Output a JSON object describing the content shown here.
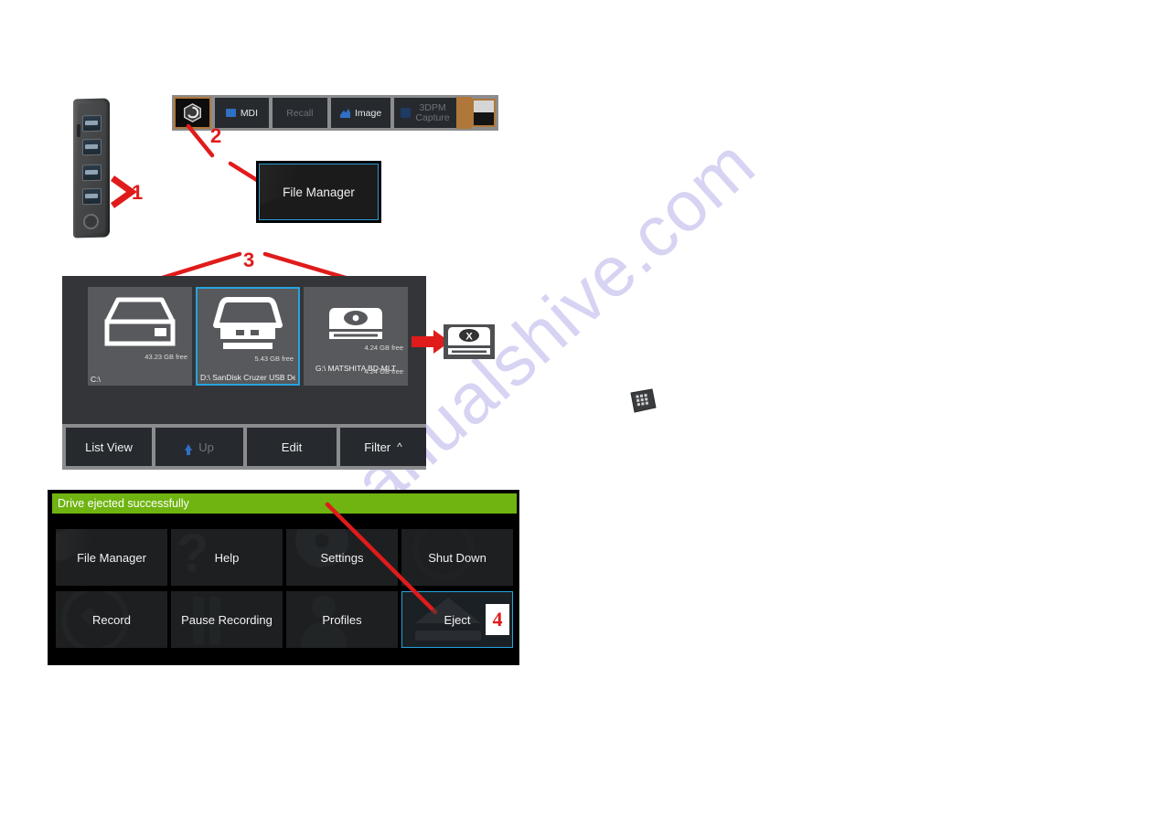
{
  "watermark": {
    "text": "manualshive.com"
  },
  "callouts": [
    {
      "id": "1",
      "label": "1"
    },
    {
      "id": "2",
      "label": "2"
    },
    {
      "id": "3",
      "label": "3"
    },
    {
      "id": "4",
      "label": "4"
    }
  ],
  "device_panel": {
    "name": "controller-side-ports",
    "usb_port_count": 4
  },
  "toolbar": {
    "logo_icon": "siemens-hmi-logo-icon",
    "buttons": [
      {
        "label": "MDI",
        "icon": "mdi-icon",
        "state": "enabled"
      },
      {
        "label": "Recall",
        "icon": "",
        "state": "disabled"
      },
      {
        "label": "Image",
        "icon": "image-icon",
        "state": "enabled"
      },
      {
        "label": "3DPM\nCapture",
        "label_line1": "3DPM",
        "label_line2": "Capture",
        "icon": "3dpm-icon",
        "state": "disabled"
      }
    ],
    "right_tile_icon": "screen-toggle-icon"
  },
  "file_manager_tile": {
    "label": "File Manager",
    "selected": true,
    "accent": "#2e9bd6"
  },
  "drives_panel": {
    "drives": [
      {
        "icon": "hard-drive-icon",
        "free_space": "43.23 GB free",
        "name": "C:\\",
        "selected": false,
        "name_align": "left"
      },
      {
        "icon": "usb-removable-drive-icon",
        "free_space": "5.43 GB free",
        "name": "D:\\ SanDisk Cruzer USB Devi...",
        "selected": true,
        "name_align": "left"
      },
      {
        "icon": "optical-disc-drive-icon",
        "free_space": "4.24 GB free",
        "name": "G:\\ MATSHITA BD-MLT",
        "free_space_2": "4.24 GB free",
        "selected": false,
        "name_align": "center"
      }
    ],
    "buttons": [
      {
        "label": "List View",
        "icon": "",
        "state": "enabled"
      },
      {
        "label": "Up",
        "icon": "up-arrow-icon",
        "state": "disabled"
      },
      {
        "label": "Edit",
        "icon": "",
        "state": "enabled"
      },
      {
        "label": "Filter",
        "icon": "chevron-up-icon",
        "state": "enabled"
      }
    ]
  },
  "eject_disc_icon": {
    "name": "eject-disc-x-icon"
  },
  "keypad_icon": {
    "name": "keypad-icon"
  },
  "menu_panel": {
    "status_banner": {
      "text": "Drive ejected successfully",
      "color": "#6fb411",
      "text_color": "#ffffff"
    },
    "tiles": [
      {
        "label": "File Manager",
        "bg_icon": "wrench-icon",
        "selected": false
      },
      {
        "label": "Help",
        "bg_icon": "question-mark-icon",
        "selected": false
      },
      {
        "label": "Settings",
        "bg_icon": "gear-icon",
        "selected": false
      },
      {
        "label": "Shut Down",
        "bg_icon": "power-icon",
        "selected": false
      },
      {
        "label": "Record",
        "bg_icon": "record-icon",
        "selected": false
      },
      {
        "label": "Pause Recording",
        "bg_icon": "pause-icon",
        "selected": false
      },
      {
        "label": "Profiles",
        "bg_icon": "person-icon",
        "selected": false
      },
      {
        "label": "Eject",
        "bg_icon": "eject-icon",
        "selected": true
      }
    ],
    "accent": "#26a4dd"
  }
}
